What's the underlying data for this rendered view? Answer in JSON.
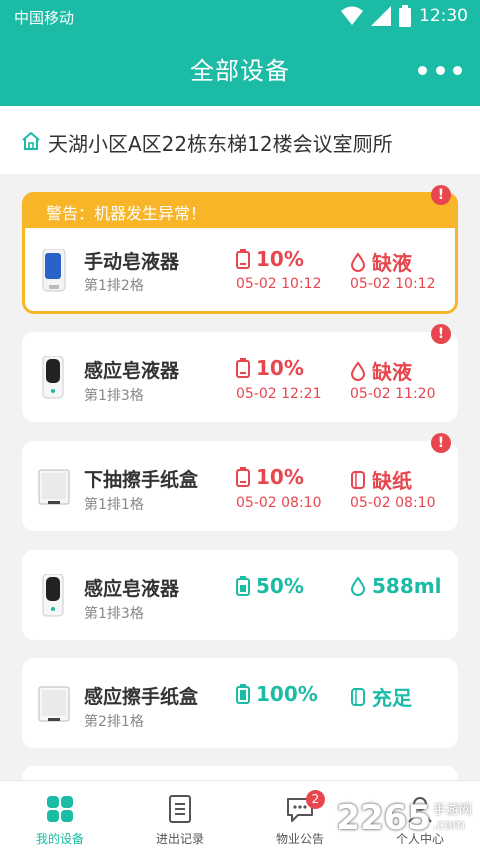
{
  "status_bar": {
    "carrier": "中国移动",
    "time": "12:30"
  },
  "header": {
    "title": "全部设备"
  },
  "location": {
    "text": "天湖小区A区22栋东梯12楼会议室厕所"
  },
  "warning": {
    "text": "警告：机器发生异常！"
  },
  "devices": [
    {
      "name": "手动皂液器",
      "position": "第1排2格",
      "battery": "10%",
      "battery_time": "05-02  10:12",
      "supply": "缺液",
      "supply_time": "05-02  10:12",
      "alert": "!"
    },
    {
      "name": "感应皂液器",
      "position": "第1排3格",
      "battery": "10%",
      "battery_time": "05-02  12:21",
      "supply": "缺液",
      "supply_time": "05-02  11:20",
      "alert": "!"
    },
    {
      "name": "下抽擦手纸盒",
      "position": "第1排1格",
      "battery": "10%",
      "battery_time": "05-02  08:10",
      "supply": "缺纸",
      "supply_time": "05-02  08:10",
      "alert": "!"
    },
    {
      "name": "感应皂液器",
      "position": "第1排3格",
      "battery": "50%",
      "supply": "588ml"
    },
    {
      "name": "感应擦手纸盒",
      "position": "第2排1格",
      "battery": "100%",
      "supply": "充足"
    }
  ],
  "tabs": [
    {
      "label": "我的设备"
    },
    {
      "label": "进出记录"
    },
    {
      "label": "物业公告",
      "badge": "2"
    },
    {
      "label": "个人中心"
    }
  ],
  "watermark": {
    "number": "2265",
    "small_top": "手游网",
    "small_bottom": ".com"
  },
  "colors": {
    "primary": "#1cbba5",
    "warning": "#f7b527",
    "alert": "#e8464e"
  }
}
